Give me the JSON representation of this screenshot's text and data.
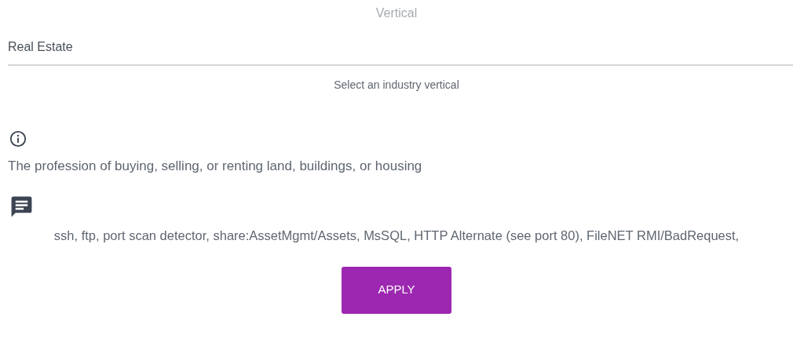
{
  "field": {
    "label": "Vertical",
    "value": "Real Estate",
    "hint": "Select an industry vertical"
  },
  "description": "The profession of buying, selling, or renting land, buildings, or housing",
  "notes": "ssh, ftp, port scan detector, share:AssetMgmt/Assets, MsSQL, HTTP Alternate (see port 80), FileNET RMI/BadRequest,",
  "button": "APPLY"
}
